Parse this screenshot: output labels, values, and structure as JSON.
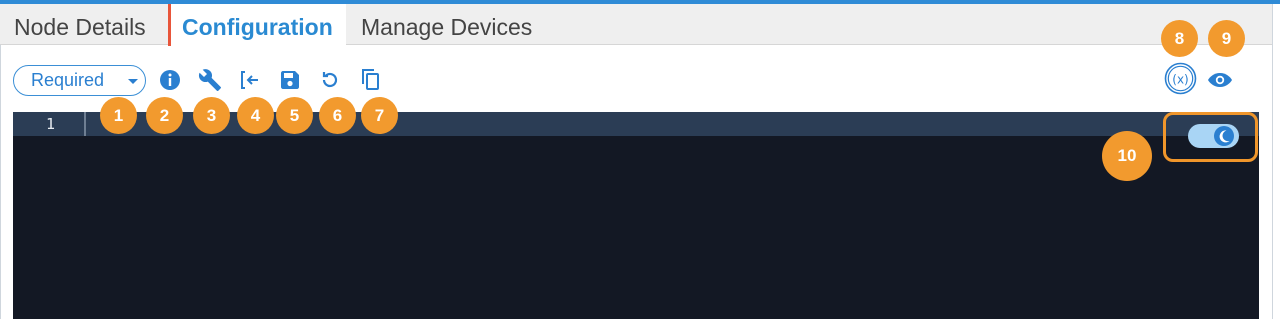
{
  "tabs": [
    {
      "label": "Node Details"
    },
    {
      "label": "Configuration",
      "active": true
    },
    {
      "label": "Manage Devices"
    }
  ],
  "toolbar": {
    "required_label": "Required",
    "icons": [
      "info-icon",
      "wrench-icon",
      "insert-from-icon",
      "save-icon",
      "undo-icon",
      "copy-icon"
    ]
  },
  "right_icons": [
    "variables-icon",
    "eye-icon"
  ],
  "editor": {
    "line_number": "1",
    "line_text": "",
    "theme_mode": "dark"
  },
  "markers": [
    "1",
    "2",
    "3",
    "4",
    "5",
    "6",
    "7",
    "8",
    "9",
    "10"
  ],
  "colors": {
    "accent": "#2a7fd0",
    "active_tab_marker": "#e8553a",
    "editor_bg": "#131824",
    "active_line_bg": "#2b3d55",
    "callout": "#f29a2e"
  }
}
